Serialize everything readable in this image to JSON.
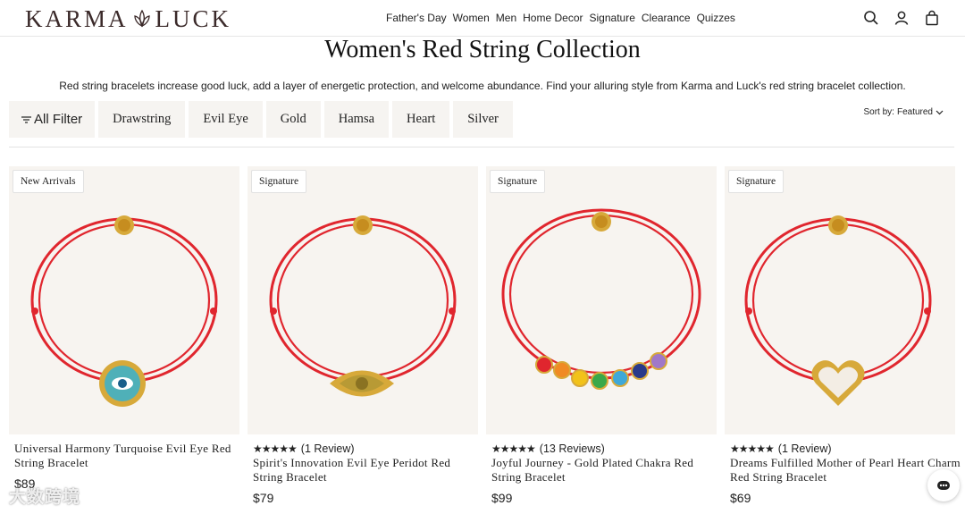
{
  "header": {
    "logo_left": "KARMA",
    "logo_right": "LUCK",
    "nav": [
      "Father's Day",
      "Women",
      "Men",
      "Home Decor",
      "Signature",
      "Clearance",
      "Quizzes"
    ]
  },
  "page": {
    "title": "Women's Red String Collection",
    "subtitle": "Red string bracelets increase good luck, add a layer of energetic protection, and welcome abundance. Find your alluring style from Karma and Luck's red string bracelet collection."
  },
  "filters": {
    "all_label": "All Filter",
    "chips": [
      "Drawstring",
      "Evil Eye",
      "Gold",
      "Hamsa",
      "Heart",
      "Silver"
    ],
    "sort_label": "Sort by:",
    "sort_value": "Featured"
  },
  "products": [
    {
      "badge": "New Arrivals",
      "rating": "",
      "reviews": "",
      "name": "Universal Harmony Turquoise Evil Eye Red String Bracelet",
      "price": "$89",
      "charm": "evil-eye-turquoise"
    },
    {
      "badge": "Signature",
      "rating": "★★★★★",
      "reviews": "(1 Review)",
      "name": "Spirit's Innovation Evil Eye Peridot Red String Bracelet",
      "price": "$79",
      "charm": "eye-peridot"
    },
    {
      "badge": "Signature",
      "rating": "★★★★★",
      "reviews": "(13 Reviews)",
      "name": "Joyful Journey - Gold Plated Chakra Red String Bracelet",
      "price": "$99",
      "charm": "chakra"
    },
    {
      "badge": "Signature",
      "rating": "★★★★★",
      "reviews": "(1 Review)",
      "name": "Dreams Fulfilled Mother of Pearl Heart Charm Red String Bracelet",
      "price": "$69",
      "charm": "pearl-heart"
    }
  ],
  "watermark": "大数跨境",
  "colors": {
    "string": "#e0262e",
    "gold": "#d7a93a",
    "card_bg": "#f7f4f0",
    "chip_bg": "#f6f4f1"
  }
}
